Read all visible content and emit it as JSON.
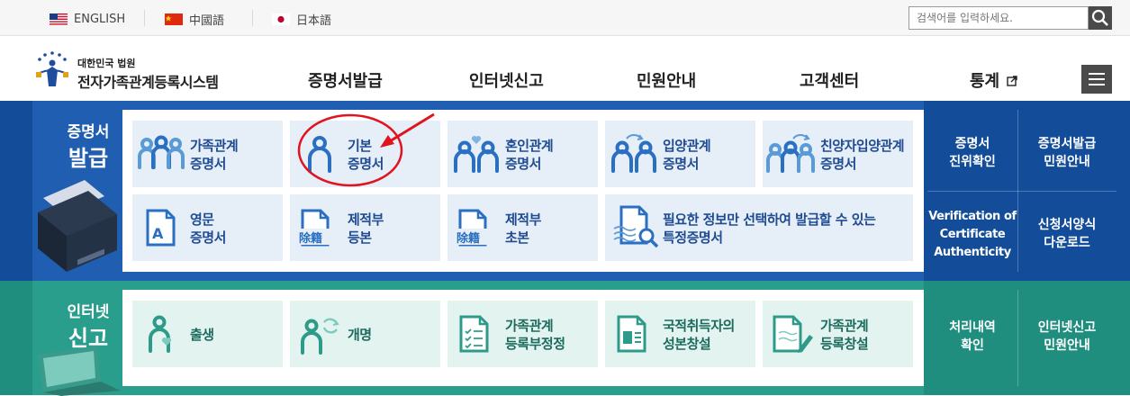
{
  "languages": [
    {
      "label": "ENGLISH",
      "flag": "us-flag"
    },
    {
      "label": "中國語",
      "flag": "china-flag"
    },
    {
      "label": "日本語",
      "flag": "japan-flag"
    }
  ],
  "search": {
    "placeholder": "검색어를 입력하세요."
  },
  "logo": {
    "top": "대한민국 법원",
    "main": "전자가족관계등록시스템"
  },
  "gnb": [
    "증명서발급",
    "인터넷신고",
    "민원안내",
    "고객센터",
    "통계"
  ],
  "issue": {
    "title1": "증명서",
    "title2": "발급",
    "tiles": [
      {
        "l1": "가족관계",
        "l2": "증명서",
        "icon": "family-three-icon"
      },
      {
        "l1": "기본",
        "l2": "증명서",
        "icon": "person-icon"
      },
      {
        "l1": "혼인관계",
        "l2": "증명서",
        "icon": "couple-heart-icon"
      },
      {
        "l1": "입양관계",
        "l2": "증명서",
        "icon": "adoption-icon"
      },
      {
        "l1": "친양자입양관계",
        "l2": "증명서",
        "icon": "adoption-family-icon"
      },
      {
        "l1": "영문",
        "l2": "증명서",
        "icon": "english-document-icon"
      },
      {
        "l1": "제적부",
        "l2": "등본",
        "icon": "removed-register-icon"
      },
      {
        "l1": "제적부",
        "l2": "초본",
        "icon": "removed-register-icon"
      },
      {
        "l1": "필요한 정보만 선택하여 발급할 수 있는",
        "l2": "특정증명서",
        "icon": "document-search-icon"
      }
    ],
    "stamp": "除籍",
    "doc_letter": "A",
    "side": [
      {
        "l1": "증명서",
        "l2": "진위확인"
      },
      {
        "l1": "증명서발급",
        "l2": "민원안내"
      },
      {
        "l1": "Verification of",
        "l2": "Certificate",
        "l3": "Authenticity"
      },
      {
        "l1": "신청서양식",
        "l2": "다운로드"
      }
    ]
  },
  "report": {
    "title1": "인터넷",
    "title2": "신고",
    "tiles": [
      {
        "l1": "출생",
        "l2": "",
        "icon": "birth-icon"
      },
      {
        "l1": "개명",
        "l2": "",
        "icon": "rename-icon"
      },
      {
        "l1": "가족관계",
        "l2": "등록부정정",
        "icon": "checklist-document-icon"
      },
      {
        "l1": "국적취득자의",
        "l2": "성본창설",
        "icon": "id-document-icon"
      },
      {
        "l1": "가족관계",
        "l2": "등록창설",
        "icon": "edit-document-icon"
      }
    ],
    "side": [
      {
        "l1": "처리내역",
        "l2": "확인"
      },
      {
        "l1": "인터넷신고",
        "l2": "민원안내"
      }
    ]
  },
  "colors": {
    "primary_blue": "#134d9a",
    "primary_green": "#1f8e7e",
    "annotation_red": "#e0141e"
  }
}
